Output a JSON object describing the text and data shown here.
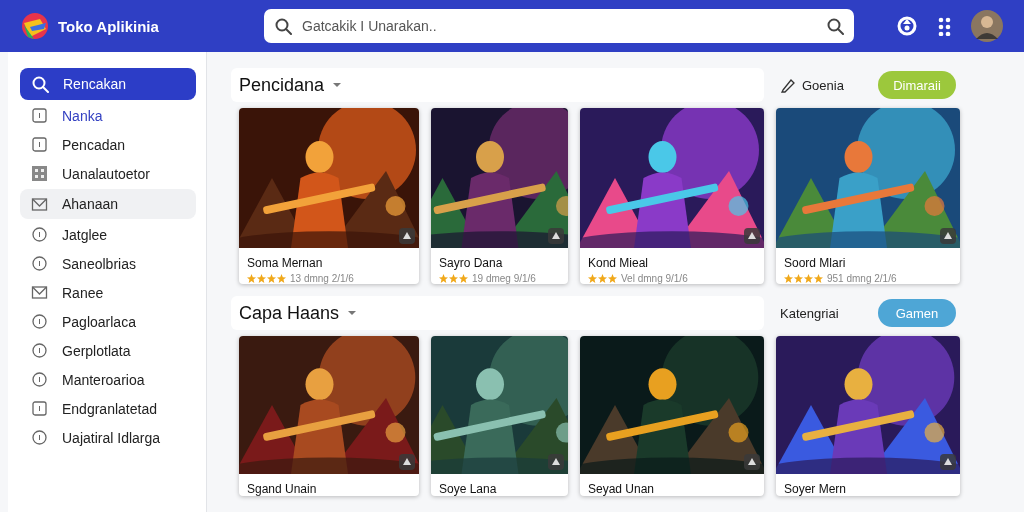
{
  "header": {
    "title": "Toko Aplikinia",
    "search": {
      "placeholder": "Gatcakik I Unarakan.."
    }
  },
  "sidebar": {
    "items": [
      {
        "label": "Rencakan",
        "selected": true,
        "active": false,
        "hovered": false
      },
      {
        "label": "Nanka",
        "selected": false,
        "active": true,
        "hovered": false
      },
      {
        "label": "Pencadan",
        "selected": false,
        "active": false,
        "hovered": false
      },
      {
        "label": "Uanalautoetor",
        "selected": false,
        "active": false,
        "hovered": false
      },
      {
        "label": "Ahanaan",
        "selected": false,
        "active": false,
        "hovered": true
      },
      {
        "label": "Jatglee",
        "selected": false,
        "active": false,
        "hovered": false
      },
      {
        "label": "Saneolbrias",
        "selected": false,
        "active": false,
        "hovered": false
      },
      {
        "label": "Ranee",
        "selected": false,
        "active": false,
        "hovered": false
      },
      {
        "label": "Pagloarlaca",
        "selected": false,
        "active": false,
        "hovered": false
      },
      {
        "label": "Gerplotlata",
        "selected": false,
        "active": false,
        "hovered": false
      },
      {
        "label": "Manteroarioa",
        "selected": false,
        "active": false,
        "hovered": false
      },
      {
        "label": "Endgranlatetad",
        "selected": false,
        "active": false,
        "hovered": false
      },
      {
        "label": "Uajatiral Idlarga",
        "selected": false,
        "active": false,
        "hovered": false
      }
    ]
  },
  "sections": [
    {
      "title": "Pencidana",
      "side_label": "Goenia",
      "button": "Dimaraii",
      "cards": [
        {
          "title": "Soma Mernan",
          "stars": 4,
          "meta": "13 dmng 2/1/6"
        },
        {
          "title": "Sayro Dana",
          "stars": 3,
          "meta": "19 dmeg 9/1/6"
        },
        {
          "title": "Kond Mieal",
          "stars": 3,
          "meta": "Vel dmng 9/1/6"
        },
        {
          "title": "Soord Mlari",
          "stars": 4,
          "meta": "951 dmng 2/1/6"
        }
      ]
    },
    {
      "title": "Capa Haans",
      "side_label": "Katengriai",
      "button": "Gamen",
      "cards": [
        {
          "title": "Sgand Unain"
        },
        {
          "title": "Soye Lana"
        },
        {
          "title": "Seyad Unan"
        },
        {
          "title": "Soyer Mern"
        }
      ]
    }
  ]
}
